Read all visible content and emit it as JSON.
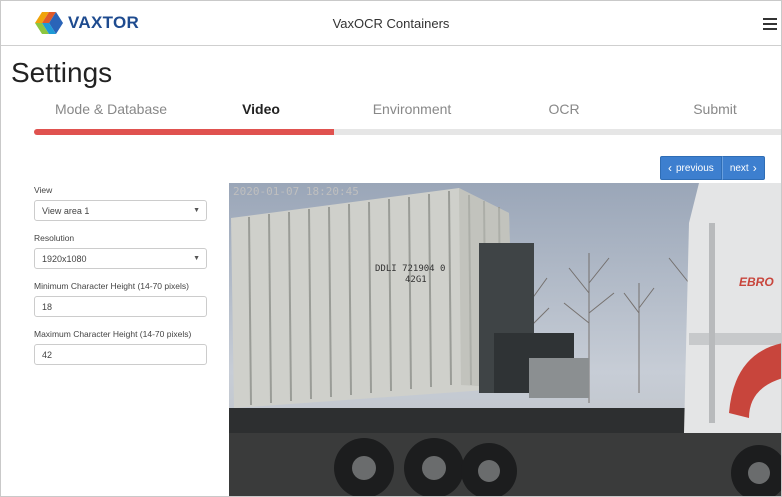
{
  "header": {
    "brand": "VAXTOR",
    "app_title": "VaxOCR Containers",
    "menu_icon": "hamburger-icon"
  },
  "page_title": "Settings",
  "steps": [
    {
      "label": "Mode & Database",
      "active": false
    },
    {
      "label": "Video",
      "active": true
    },
    {
      "label": "Environment",
      "active": false
    },
    {
      "label": "OCR",
      "active": false
    },
    {
      "label": "Submit",
      "active": false
    }
  ],
  "progress": {
    "fraction": 0.4,
    "color": "#e0524f"
  },
  "nav": {
    "previous_label": "previous",
    "next_label": "next",
    "previous_icon": "chevron-left-icon",
    "next_icon": "chevron-right-icon"
  },
  "form": {
    "view": {
      "label": "View",
      "value": "View area 1"
    },
    "resolution": {
      "label": "Resolution",
      "value": "1920x1080"
    },
    "min_char_height": {
      "label": "Minimum Character Height (14-70 pixels)",
      "value": "18"
    },
    "max_char_height": {
      "label": "Maximum Character Height (14-70 pixels)",
      "value": "42"
    }
  },
  "video": {
    "timestamp": "2020-01-07 18:20:45",
    "container_code_line1": "DDLI 721904 0",
    "container_code_line2": "42G1",
    "truck_brand": "EBRO"
  },
  "colors": {
    "accent": "#3d7fcf",
    "brand": "#1e4b8f",
    "progress": "#e0524f"
  }
}
